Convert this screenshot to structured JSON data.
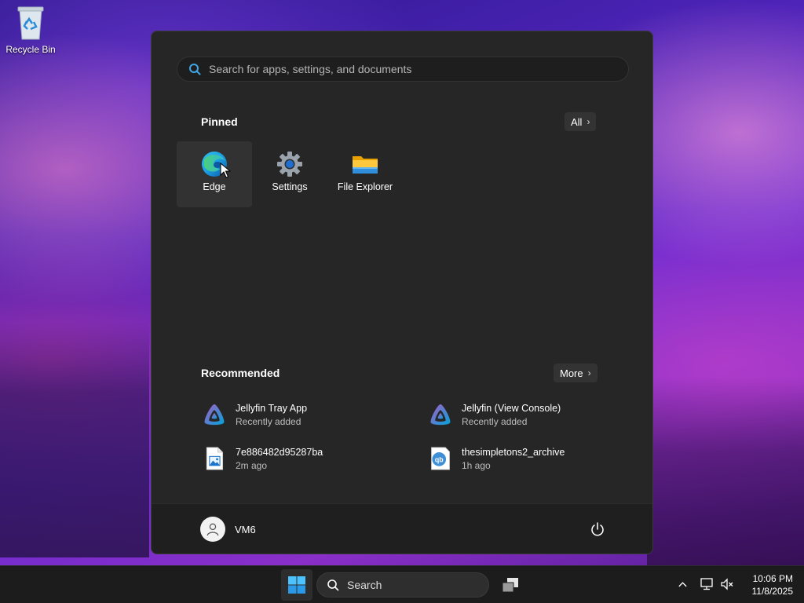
{
  "desktop": {
    "icons": [
      {
        "label": "Recycle Bin",
        "icon": "recycle-bin-icon"
      }
    ]
  },
  "start_menu": {
    "search": {
      "placeholder": "Search for apps, settings, and documents",
      "icon": "search-icon"
    },
    "pinned": {
      "title": "Pinned",
      "all_label": "All",
      "items": [
        {
          "label": "Edge",
          "icon": "edge-icon"
        },
        {
          "label": "Settings",
          "icon": "gear-icon"
        },
        {
          "label": "File Explorer",
          "icon": "folder-icon"
        }
      ]
    },
    "recommended": {
      "title": "Recommended",
      "more_label": "More",
      "items": [
        {
          "name": "Jellyfin Tray App",
          "sub": "Recently added",
          "icon": "jellyfin-icon"
        },
        {
          "name": "Jellyfin (View Console)",
          "sub": "Recently added",
          "icon": "jellyfin-icon"
        },
        {
          "name": "7e886482d95287ba",
          "sub": "2m ago",
          "icon": "image-file-icon"
        },
        {
          "name": "thesimpletons2_archive",
          "sub": "1h ago",
          "icon": "qbittorrent-file-icon"
        }
      ]
    },
    "user": {
      "name": "VM6"
    }
  },
  "taskbar": {
    "search_label": "Search",
    "clock": {
      "time": "10:06 PM",
      "date": "11/8/2025"
    }
  },
  "colors": {
    "menu_bg": "#262626",
    "footer_bg": "#1f1f1f",
    "taskbar_bg": "#1c1c1c",
    "accent": "#0078d4"
  }
}
